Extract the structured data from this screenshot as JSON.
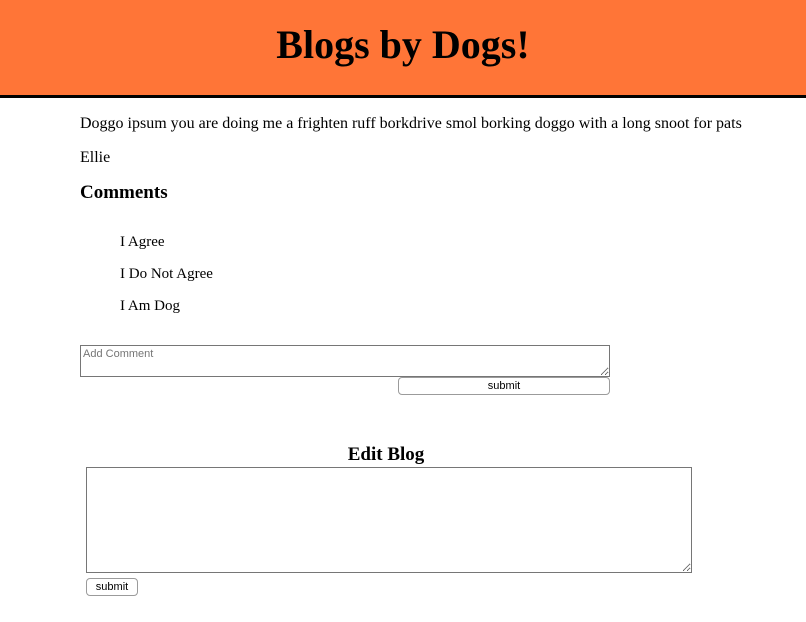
{
  "header": {
    "title": "Blogs by Dogs!",
    "background": "#ff7537"
  },
  "blog": {
    "body": "Doggo ipsum you are doing me a frighten ruff borkdrive smol borking doggo with a long snoot for pats",
    "author": "Ellie"
  },
  "comments": {
    "heading": "Comments",
    "items": [
      {
        "text": "I Agree"
      },
      {
        "text": "I Do Not Agree"
      },
      {
        "text": "I Am Dog"
      }
    ],
    "input_placeholder": "Add Comment",
    "input_value": "",
    "submit_label": "submit"
  },
  "edit": {
    "heading": "Edit Blog",
    "textarea_value": "",
    "submit_label": "submit"
  }
}
